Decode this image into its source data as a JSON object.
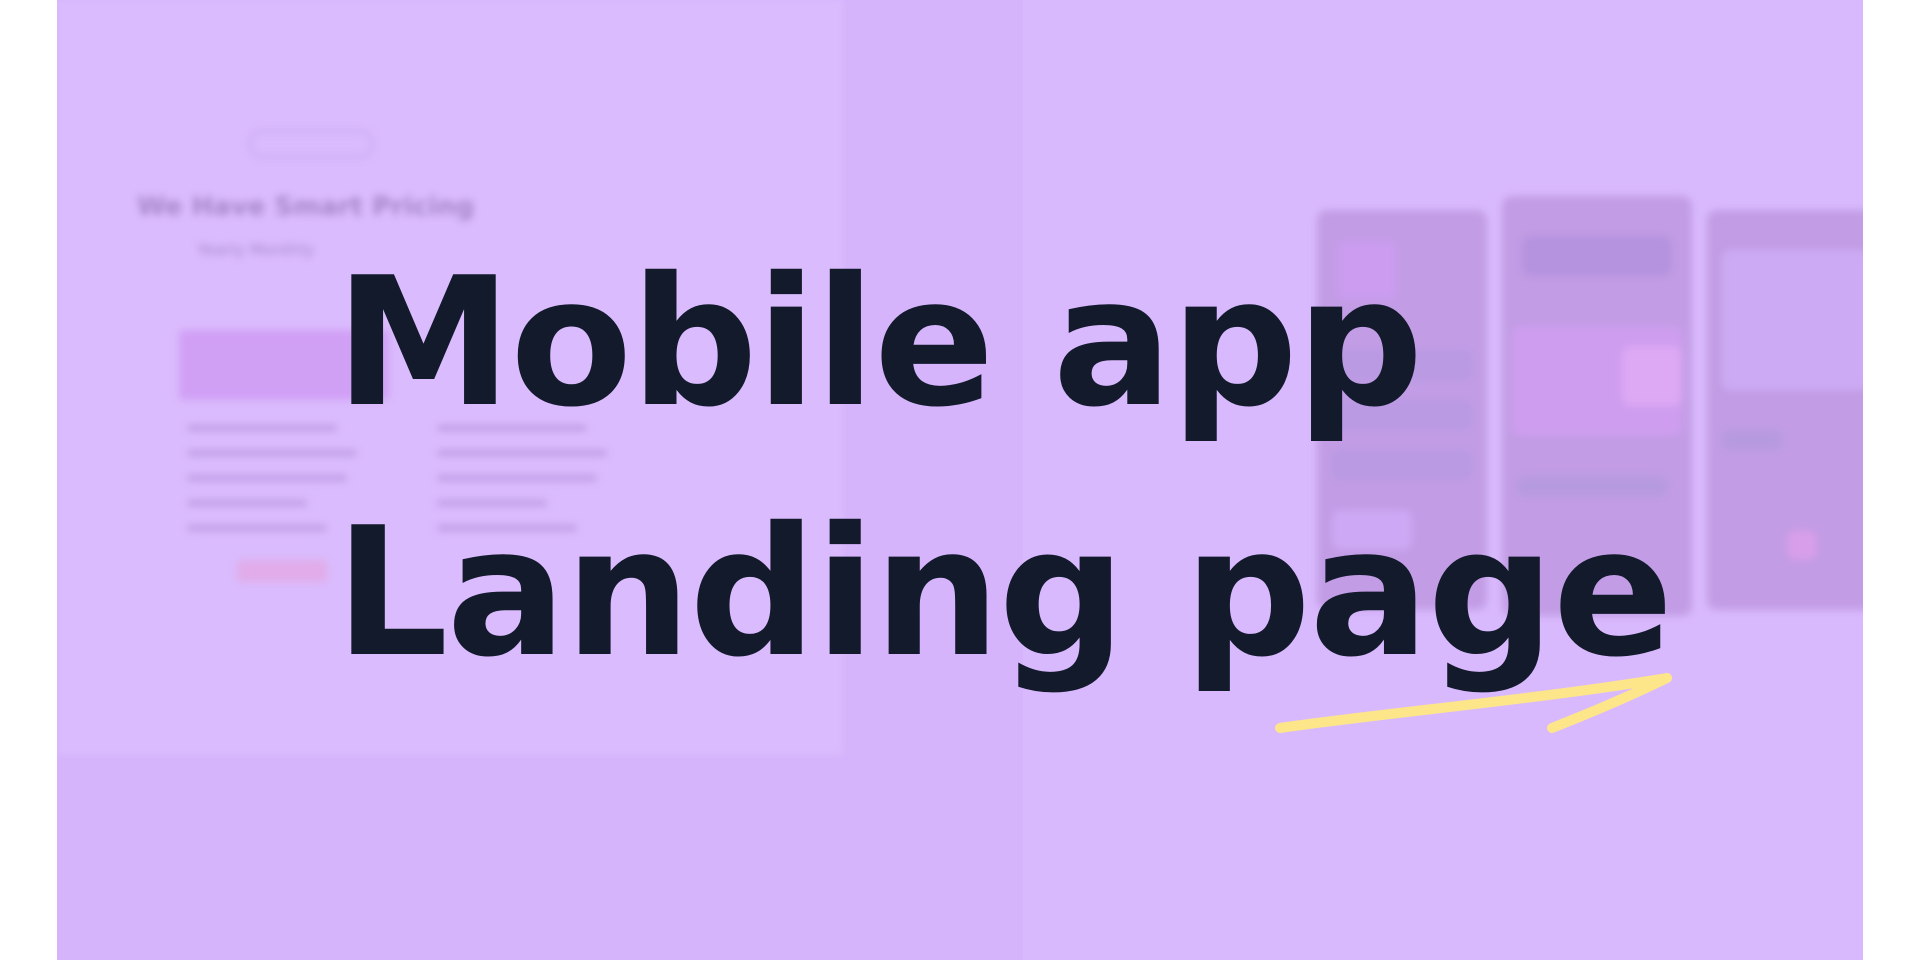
{
  "headline": {
    "line1": "Mobile app",
    "line2": "Landing page"
  },
  "background_mockup": {
    "pricing_heading": "We Have Smart Pricing",
    "toggle_text": "Yearly  Monthly"
  },
  "colors": {
    "background": "#d6b4fc",
    "headline_text": "#121a2c",
    "swoosh": "#fde58a"
  },
  "icons": {
    "swoosh": "underline-arrow-icon"
  }
}
